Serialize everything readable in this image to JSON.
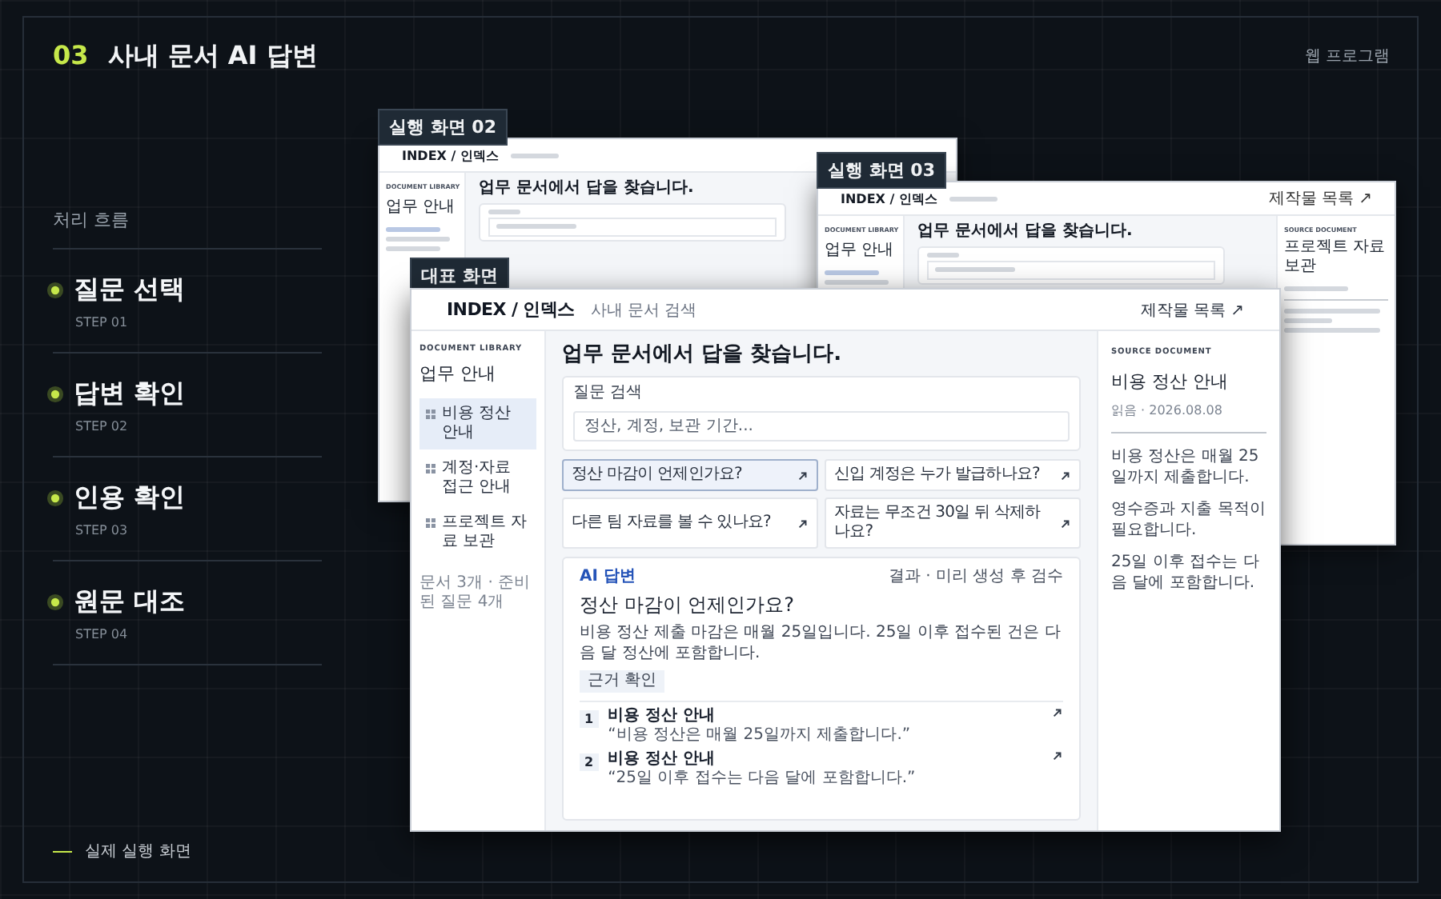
{
  "section": {
    "number": "03",
    "title": "사내 문서 AI 답변"
  },
  "category": "웹 프로그램",
  "flow": {
    "title": "처리 흐름",
    "steps": [
      {
        "title": "질문 선택",
        "step": "STEP 01"
      },
      {
        "title": "답변 확인",
        "step": "STEP 02"
      },
      {
        "title": "인용 확인",
        "step": "STEP 03"
      },
      {
        "title": "원문 대조",
        "step": "STEP 04"
      }
    ]
  },
  "footer": "실제 실행 화면",
  "screens": [
    {
      "label": "실행 화면 02",
      "logo": "INDEX / 인덱스",
      "library_label": "DOCUMENT LIBRARY",
      "sidebar_title": "업무 안내",
      "heading": "업무 문서에서 답을 찾습니다."
    },
    {
      "label": "실행 화면 03",
      "logo": "INDEX / 인덱스",
      "header_link": "제작물 목록 ↗",
      "library_label": "DOCUMENT LIBRARY",
      "sidebar_title": "업무 안내",
      "heading": "업무 문서에서 답을 찾습니다.",
      "source": {
        "eyebrow": "SOURCE DOCUMENT",
        "title": "프로젝트 자료 보관"
      }
    }
  ],
  "main_screen": {
    "label": "대표 화면",
    "header": {
      "logo": "INDEX / 인덱스",
      "subtitle": "사내 문서 검색",
      "link": "제작물 목록 ↗"
    },
    "sidebar": {
      "eyebrow": "DOCUMENT LIBRARY",
      "title": "업무 안내",
      "items": [
        {
          "label": "비용 정산 안내",
          "selected": true
        },
        {
          "label": "계정·자료 접근 안내",
          "selected": false
        },
        {
          "label": "프로젝트 자료 보관",
          "selected": false
        }
      ],
      "footer": "문서 3개 · 준비된 질문 4개"
    },
    "heading": "업무 문서에서 답을 찾습니다.",
    "search": {
      "label": "질문 검색",
      "placeholder": "정산, 계정, 보관 기간..."
    },
    "questions": [
      {
        "text": "정산 마감이 언제인가요?",
        "selected": true
      },
      {
        "text": "신입 계정은 누가 발급하나요?",
        "selected": false
      },
      {
        "text": "다른 팀 자료를 볼 수 있나요?",
        "selected": false
      },
      {
        "text": "자료는 무조건 30일 뒤 삭제하나요?",
        "selected": false
      }
    ],
    "answer": {
      "tag": "AI 답변",
      "status": "결과 · 미리 생성 후 검수",
      "question": "정산 마감이 언제인가요?",
      "text": "비용 정산 제출 마감은 매월 25일입니다. 25일 이후 접수된 건은 다음 달 정산에 포함합니다.",
      "evidence_button": "근거 확인",
      "citations": [
        {
          "number": "1",
          "title": "비용 정산 안내",
          "quote": "“비용 정산은 매월 25일까지 제출합니다.”"
        },
        {
          "number": "2",
          "title": "비용 정산 안내",
          "quote": "“25일 이후 접수는 다음 달에 포함합니다.”"
        }
      ]
    },
    "source": {
      "eyebrow": "SOURCE DOCUMENT",
      "title": "비용 정산 안내",
      "meta": "읽음 · 2026.08.08",
      "paragraphs": [
        "비용 정산은 매월 25일까지 제출합니다.",
        "영수증과 지출 목적이 필요합니다.",
        "25일 이후 접수는 다음 달에 포함합니다."
      ]
    }
  }
}
